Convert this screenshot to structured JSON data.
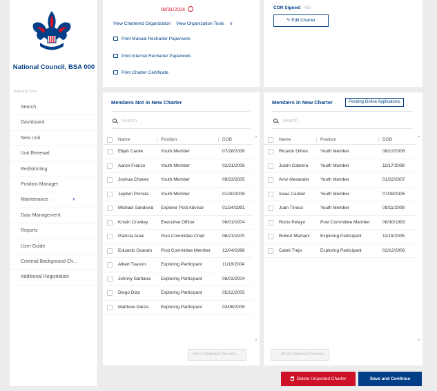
{
  "org": {
    "name": "National Council, BSA 000"
  },
  "sidebar": {
    "section_title": "Registrar Tools",
    "items": [
      {
        "label": "Search"
      },
      {
        "label": "Dashboard"
      },
      {
        "label": "New Unit"
      },
      {
        "label": "Unit Renewal"
      },
      {
        "label": "Redistricting"
      },
      {
        "label": "Position Manager"
      },
      {
        "label": "Maintenance",
        "expandable": true
      },
      {
        "label": "Data Management"
      },
      {
        "label": "Reports"
      },
      {
        "label": "User Guide"
      },
      {
        "label": "Criminal Background Ch..."
      },
      {
        "label": "Additional Registration"
      }
    ]
  },
  "charter": {
    "date": "08/31/2024",
    "link_chartered_org": "View Chartered Organization",
    "link_org_tools": "View Organization Tools",
    "print_manual": "Print Manual Recharter Paperwork",
    "print_internet": "Print Internet Recharter Paperwork",
    "print_certificate": "Print Charter Certificate",
    "cor_label": "COR Signed:",
    "cor_value": "NO",
    "edit_button": "Edit Charter"
  },
  "not_in_charter": {
    "title": "Members Not in New Charter",
    "search_placeholder": "Search",
    "columns": {
      "name": "Name",
      "position": "Position",
      "dob": "DOB"
    },
    "rows": [
      {
        "name": "Elijah Caoile",
        "position": "Youth Member",
        "dob": "07/28/2008"
      },
      {
        "name": "Aaron Franco",
        "position": "Youth Member",
        "dob": "02/21/2008"
      },
      {
        "name": "Joshua Chavez",
        "position": "Youth Member",
        "dob": "09/23/2005"
      },
      {
        "name": "Jayden Porrata",
        "position": "Youth Member",
        "dob": "01/30/2008"
      },
      {
        "name": "Michael Sandoval",
        "position": "Explorer Post Advisor",
        "dob": "01/24/1991"
      },
      {
        "name": "Kristin Crowley",
        "position": "Executive Officer",
        "dob": "06/01/1974"
      },
      {
        "name": "Patricia Arias",
        "position": "Post Committee Chair",
        "dob": "06/21/1970"
      },
      {
        "name": "Eduardo Ovando",
        "position": "Post Committee Member",
        "dob": "12/04/1998"
      },
      {
        "name": "Albert Tuason",
        "position": "Exploring Participant",
        "dob": "11/18/2004"
      },
      {
        "name": "Johnny Santana",
        "position": "Exploring Participant",
        "dob": "08/03/2004"
      },
      {
        "name": "Diego Diaz",
        "position": "Exploring Participant",
        "dob": "05/12/2005"
      },
      {
        "name": "Matthew Garza",
        "position": "Exploring Participant",
        "dob": "03/06/2005"
      }
    ],
    "move_button": "Move Selected Persons →"
  },
  "in_charter": {
    "title": "Members in New Charter",
    "pending_button": "Pending Online Applications",
    "search_placeholder": "Search",
    "columns": {
      "name": "Name",
      "position": "Position",
      "dob": "DOB"
    },
    "rows": [
      {
        "name": "Ricardo Othon",
        "position": "Youth Member",
        "dob": "08/12/2006"
      },
      {
        "name": "Justin Cabrera",
        "position": "Youth Member",
        "dob": "11/17/2008"
      },
      {
        "name": "Amir Alexander",
        "position": "Youth Member",
        "dob": "01/22/2007"
      },
      {
        "name": "Isaac Cardiel",
        "position": "Youth Member",
        "dob": "07/08/2006"
      },
      {
        "name": "Juan Tinoco",
        "position": "Youth Member",
        "dob": "09/11/2008"
      },
      {
        "name": "Rocio Pelayo",
        "position": "Post Committee Member",
        "dob": "06/30/1993"
      },
      {
        "name": "Robert Mamani",
        "position": "Exploring Participant",
        "dob": "11/15/2005"
      },
      {
        "name": "Caleb Trejo",
        "position": "Exploring Participant",
        "dob": "02/12/2006"
      }
    ],
    "move_button": "← Move Selected Persons"
  },
  "actions": {
    "delete": "Delete Unposted Charter",
    "save": "Save and Continue"
  },
  "colors": {
    "brand_blue": "#003f87",
    "brand_red": "#ce1126"
  },
  "icons": [
    "bsa-logo-icon",
    "clock-icon",
    "chevron-down-icon",
    "pencil-icon",
    "printer-icon",
    "search-icon",
    "trash-icon"
  ]
}
